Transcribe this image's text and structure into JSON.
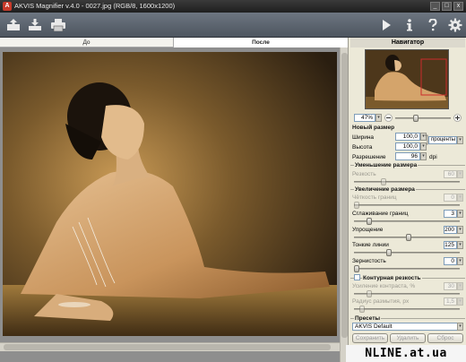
{
  "window": {
    "title": "AKVIS Magnifier v.4.0 - 0027.jpg (RGB/8, 1600x1200)",
    "app_icon_glyph": "A",
    "min_glyph": "_",
    "max_glyph": "□",
    "close_glyph": "x"
  },
  "toolbar": {
    "left_icons": [
      "open-icon",
      "save-icon",
      "print-icon"
    ],
    "right_icons": [
      "run-icon",
      "info-icon",
      "help-icon",
      "settings-icon"
    ]
  },
  "tabs": {
    "before": "До",
    "after": "После"
  },
  "navigator": {
    "title": "Навигатор",
    "zoom": "47%"
  },
  "new_size": {
    "title": "Новый размер",
    "width_label": "Ширина",
    "width_value": "100,0",
    "height_label": "Высота",
    "height_value": "100,0",
    "unit": "проценты",
    "resolution_label": "Разрешение",
    "resolution_value": "96",
    "resolution_unit": "dpi"
  },
  "reduce": {
    "title": "Уменьшение размера",
    "sharpness_label": "Резкость",
    "sharpness_value": "60"
  },
  "enlarge": {
    "title": "Увеличение размера",
    "edge_sharpness_label": "Чёткость границ",
    "edge_sharpness_value": "0",
    "smoothing_label": "Сглаживание границ",
    "smoothing_value": "3",
    "simplification_label": "Упрощение",
    "simplification_value": "200",
    "fine_lines_label": "Тонкие линии",
    "fine_lines_value": "125",
    "grain_label": "Зернистость",
    "grain_value": "0"
  },
  "unsharp": {
    "title": "Контурная резкость",
    "contrast_label": "Усиление контраста, %",
    "contrast_value": "30",
    "radius_label": "Радиус размытия, px",
    "radius_value": "1,5"
  },
  "presets": {
    "title": "Пресеты",
    "selected": "AKVIS Default",
    "save_label": "Сохранить",
    "delete_label": "Удалить",
    "reset_label": "Сброс"
  },
  "watermark": "NLINE.at.ua",
  "colors": {
    "toolbar": "#5d6570",
    "titlebar": "#2a2a2a",
    "panel": "#ece9d8"
  }
}
